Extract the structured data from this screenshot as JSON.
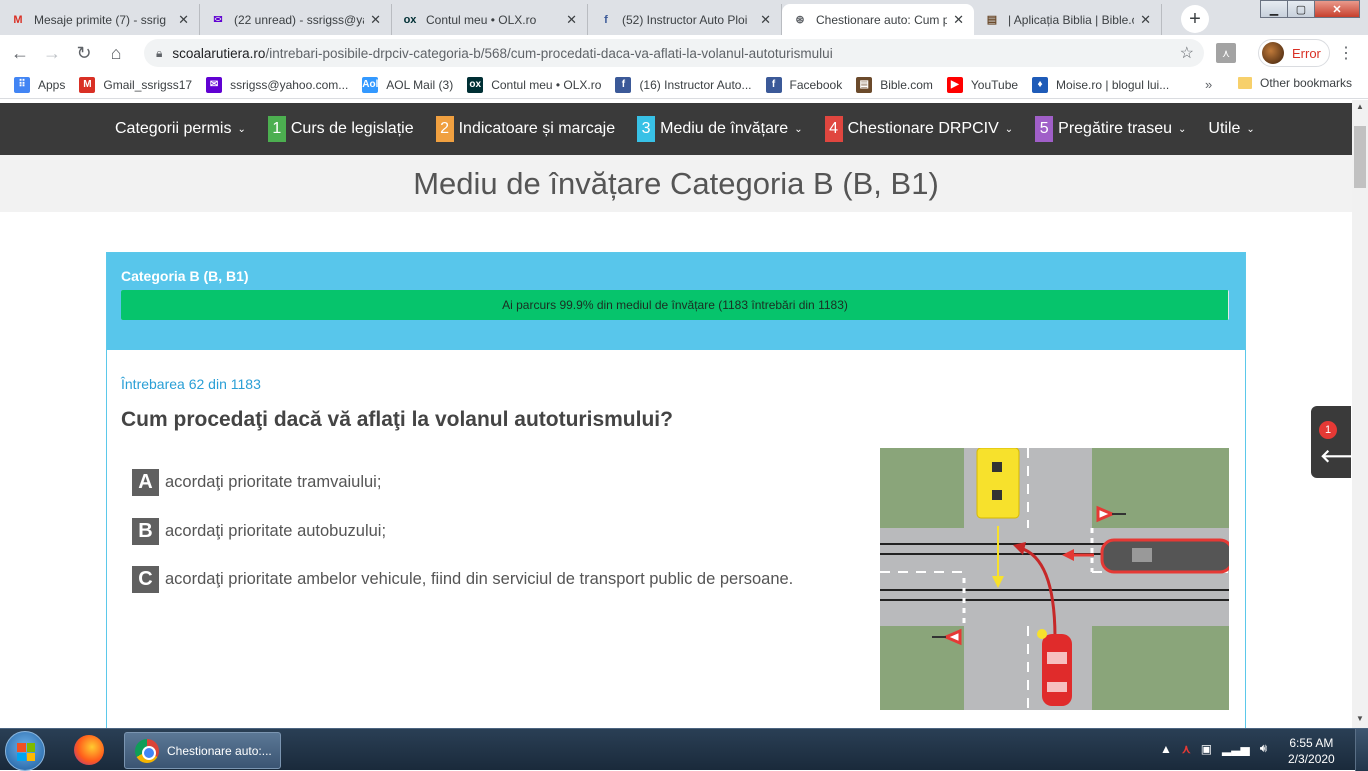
{
  "browser": {
    "tabs": [
      {
        "icon": "gmail-icon",
        "title": "Mesaje primite (7) - ssrig"
      },
      {
        "icon": "yahoo-mail-icon",
        "title": "(22 unread) - ssrigss@ya"
      },
      {
        "icon": "olx-icon",
        "title": "Contul meu • OLX.ro"
      },
      {
        "icon": "facebook-icon",
        "title": "(52) Instructor Auto Ploi"
      },
      {
        "icon": "steering-wheel-icon",
        "title": "Chestionare auto: Cum p"
      },
      {
        "icon": "bible-icon",
        "title": "| Aplicația Biblia | Bible.c"
      }
    ],
    "url_domain": "scoalarutiera.ro",
    "url_path": "/intrebari-posibile-drpciv-categoria-b/568/cum-procedati-daca-va-aflati-la-volanul-autoturismului",
    "profile_status": "Error",
    "bookmarks": [
      {
        "icon": "apps-grid-icon",
        "label": "Apps",
        "color": "#4285f4"
      },
      {
        "icon": "gmail-icon",
        "label": "Gmail_ssrigss17",
        "color": "#d93025"
      },
      {
        "icon": "yahoo-mail-icon",
        "label": "ssrigss@yahoo.com...",
        "color": "#6001d2"
      },
      {
        "icon": "aol-icon",
        "label": "AOL Mail (3)",
        "color": "#3399ff"
      },
      {
        "icon": "olx-icon",
        "label": "Contul meu • OLX.ro",
        "color": "#002f34"
      },
      {
        "icon": "facebook-icon",
        "label": "(16) Instructor Auto...",
        "color": "#3b5998"
      },
      {
        "icon": "facebook-icon",
        "label": "Facebook",
        "color": "#3b5998"
      },
      {
        "icon": "bible-icon",
        "label": "Bible.com",
        "color": "#6b4a2b"
      },
      {
        "icon": "youtube-icon",
        "label": "YouTube",
        "color": "#ff0000"
      },
      {
        "icon": "moise-icon",
        "label": "Moise.ro | blogul lui...",
        "color": "#1e5bb8"
      }
    ],
    "bookmarks_more": "»",
    "other_bookmarks": "Other bookmarks"
  },
  "site": {
    "nav": [
      {
        "num": "",
        "label": "Categorii permis",
        "color": ""
      },
      {
        "num": "1",
        "label": "Curs de legislație",
        "color": "#4caf50"
      },
      {
        "num": "2",
        "label": "Indicatoare și marcaje",
        "color": "#f0a040"
      },
      {
        "num": "3",
        "label": "Mediu de învățare",
        "color": "#38c1e6"
      },
      {
        "num": "4",
        "label": "Chestionare DRPCIV",
        "color": "#e0463f"
      },
      {
        "num": "5",
        "label": "Pregătire traseu",
        "color": "#a05fc8"
      },
      {
        "num": "",
        "label": "Utile",
        "color": ""
      }
    ],
    "page_title": "Mediu de învățare Categoria B (B, B1)",
    "category_label": "Categoria B (B, B1)",
    "progress_text": "Ai parcurs 99.9% din mediul de învățare (1183 întrebări din 1183)",
    "progress_percent": 99.9,
    "question_counter": "Întrebarea 62 din 1183",
    "question_text": "Cum procedaţi dacă vă aflaţi la volanul autoturismului?",
    "answers": [
      {
        "letter": "A",
        "text": "acordaţi prioritate tramvaiului;"
      },
      {
        "letter": "B",
        "text": "acordaţi prioritate autobuzului;"
      },
      {
        "letter": "C",
        "text": "acordaţi prioritate ambelor vehicule, fiind din serviciul de transport public de persoane."
      }
    ],
    "side_badge": "1"
  },
  "taskbar": {
    "active_app": "Chestionare auto:...",
    "time": "6:55 AM",
    "date": "2/3/2020"
  }
}
